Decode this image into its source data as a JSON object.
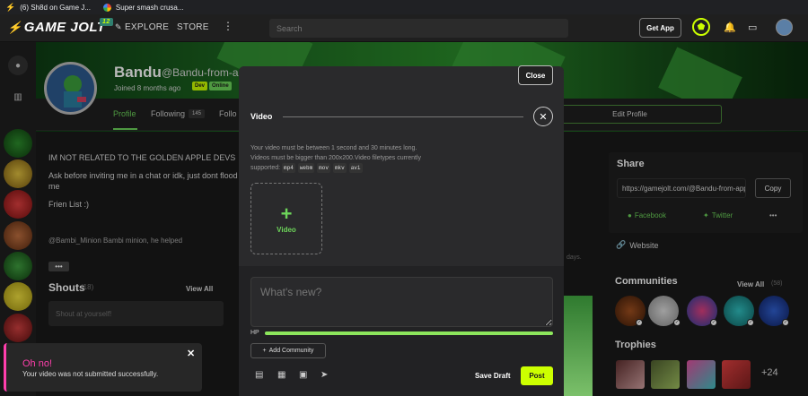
{
  "browser": {
    "bookmarks": [
      {
        "label": "(6) Sh8d on Game J...",
        "icon": "lightning-icon"
      },
      {
        "label": "Super smash crusa...",
        "icon": "google-icon"
      }
    ]
  },
  "nav": {
    "logo": "GAME JOLT",
    "notification_count": "12",
    "explore": "EXPLORE",
    "store": "STORE",
    "more": "⋮",
    "search_placeholder": "Search",
    "get_app": "Get App"
  },
  "profile": {
    "name": "Bandu",
    "handle": "@Bandu-from-app",
    "joined": "Joined 8 months ago",
    "tag_dev": "Dev",
    "tag_online": "Online",
    "tabs": {
      "profile": "Profile",
      "following": "Following",
      "following_count": "145",
      "followers": "Follo"
    },
    "edit_profile": "Edit Profile",
    "bio": [
      "IM NOT RELATED TO THE GOLDEN APPLE DEVS",
      "Ask before inviting me in a chat or idk, just dont flood me",
      "Frien List :)"
    ],
    "bio_mention": "@Bambi_Minion  Bambi minion, he helped",
    "bio_more": "•••",
    "days_text": "days."
  },
  "shouts": {
    "title": "Shouts",
    "count": "(18)",
    "view_all": "View All",
    "placeholder": "Shout at yourself!"
  },
  "share": {
    "title": "Share",
    "url": "https://gamejolt.com/@Bandu-from-app",
    "copy": "Copy",
    "facebook": "Facebook",
    "twitter": "Twitter",
    "more": "•••",
    "website": "Website"
  },
  "communities": {
    "title": "Communities",
    "view_all": "View All",
    "count": "(58)"
  },
  "trophies": {
    "title": "Trophies",
    "more": "+24"
  },
  "modal": {
    "close": "Close",
    "video_title": "Video",
    "video_help_1": "Your video must be between 1 second and 30 minutes long.",
    "video_help_2": "Videos must be bigger than 200x200.Video filetypes currently",
    "video_help_3": "supported:",
    "filetypes": [
      "mp4",
      "webm",
      "mov",
      "mkv",
      "avi"
    ],
    "video_add_label": "Video",
    "whats_new_placeholder": "What's new?",
    "hp_label": "HP",
    "hp_fraction": 1.0,
    "add_community": "Add Community",
    "save_draft": "Save Draft",
    "post": "Post"
  },
  "toast": {
    "title": "Oh no!",
    "message": "Your video was not submitted successfully."
  },
  "colors": {
    "accent_green": "#6dd55a",
    "accent_lime": "#ccff00",
    "toast_pink": "#ff3fac"
  }
}
